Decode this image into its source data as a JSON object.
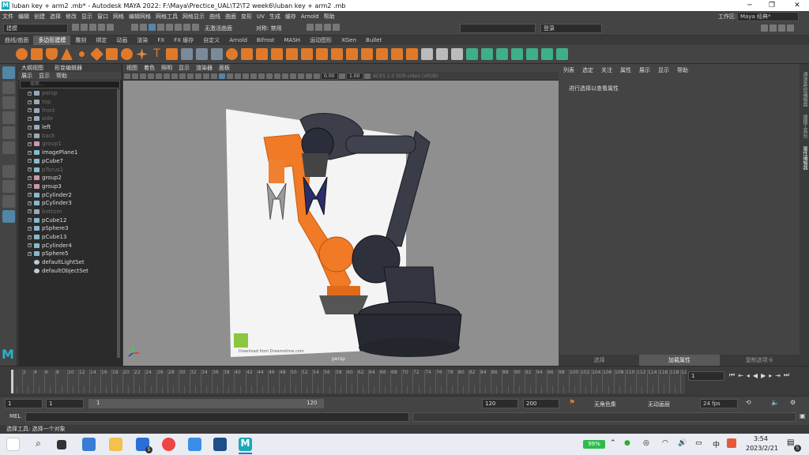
{
  "window": {
    "title": "luban key + arm2 .mb* - Autodesk MAYA 2022: F:\\Maya\\Prectice_UAL\\T2\\T2 week6\\luban key + arm2 .mb",
    "logo": "M"
  },
  "menubar": [
    "文件",
    "编辑",
    "创建",
    "选择",
    "修改",
    "显示",
    "窗口",
    "网格",
    "编辑网格",
    "网格工具",
    "网格显示",
    "曲线",
    "曲面",
    "变形",
    "UV",
    "生成",
    "缓存",
    "Arnold",
    "帮助"
  ],
  "workspace": {
    "label": "工作区:",
    "value": "Maya 经典*"
  },
  "statusline": {
    "mode": "建模",
    "symmetry": "对称: 禁用",
    "no_live": "无激活曲面",
    "login": "登录"
  },
  "shelf_tabs": [
    "曲线/曲面",
    "多边形建模",
    "雕刻",
    "绑定",
    "动画",
    "渲染",
    "FX",
    "FX 缓存",
    "自定义",
    "Arnold",
    "Bifrost",
    "MASH",
    "运动图形",
    "XGen",
    "Bullet"
  ],
  "shelf_active": "多边形建模",
  "outliner": {
    "title": "大纲视图",
    "title2": "形变编辑器",
    "menus": [
      "展示",
      "显示",
      "帮助"
    ],
    "search_placeholder": "搜索...",
    "items": [
      {
        "name": "persp",
        "type": "cam",
        "dim": true
      },
      {
        "name": "top",
        "type": "cam",
        "dim": true
      },
      {
        "name": "front",
        "type": "cam",
        "dim": true
      },
      {
        "name": "side",
        "type": "cam",
        "dim": true
      },
      {
        "name": "left",
        "type": "cam",
        "dim": false
      },
      {
        "name": "back",
        "type": "cam",
        "dim": true
      },
      {
        "name": "group1",
        "type": "grp",
        "dim": true
      },
      {
        "name": "imagePlane1",
        "type": "mesh",
        "dim": false
      },
      {
        "name": "pCube7",
        "type": "mesh",
        "dim": false
      },
      {
        "name": "pTorus1",
        "type": "mesh",
        "dim": true
      },
      {
        "name": "group2",
        "type": "grp",
        "dim": false
      },
      {
        "name": "group3",
        "type": "grp",
        "dim": false
      },
      {
        "name": "pCylinder2",
        "type": "mesh",
        "dim": false
      },
      {
        "name": "pCylinder3",
        "type": "mesh",
        "dim": false
      },
      {
        "name": "bottom",
        "type": "cam",
        "dim": true
      },
      {
        "name": "pCube12",
        "type": "mesh",
        "dim": false
      },
      {
        "name": "pSphere3",
        "type": "mesh",
        "dim": false
      },
      {
        "name": "pCube13",
        "type": "mesh",
        "dim": false
      },
      {
        "name": "pCylinder4",
        "type": "mesh",
        "dim": false
      },
      {
        "name": "pSphere5",
        "type": "mesh",
        "dim": false
      },
      {
        "name": "defaultLightSet",
        "type": "set",
        "dim": false
      },
      {
        "name": "defaultObjectSet",
        "type": "set",
        "dim": false
      }
    ]
  },
  "viewport": {
    "menus": [
      "视图",
      "着色",
      "照明",
      "显示",
      "渲染器",
      "面板"
    ],
    "exposure": "0.00",
    "gamma": "1.00",
    "colorspace": "ACES 1.0 SDR-video (sRGB)",
    "camera_label": "persp",
    "watermark": "Download from Dreamstime.com"
  },
  "attr_editor": {
    "tabs": [
      "列表",
      "选定",
      "关注",
      "属性",
      "展示",
      "显示",
      "帮助"
    ],
    "message": "进行选择以查看属性",
    "bottom": [
      "选择",
      "加载属性",
      "复制选项卡"
    ],
    "bottom_active": "加载属性"
  },
  "side_tabs": [
    "通道盒/层编辑器",
    "建模工具包",
    "属性编辑器"
  ],
  "timeline": {
    "current_frame": "1",
    "ticks": [
      "2",
      "4",
      "6",
      "8",
      "10",
      "12",
      "14",
      "16",
      "18",
      "20",
      "22",
      "24",
      "26",
      "28",
      "30",
      "32",
      "34",
      "36",
      "38",
      "40",
      "42",
      "44",
      "46",
      "48",
      "50",
      "52",
      "54",
      "56",
      "58",
      "60",
      "62",
      "64",
      "66",
      "68",
      "70",
      "72",
      "74",
      "76",
      "78",
      "80",
      "82",
      "84",
      "86",
      "88",
      "90",
      "92",
      "94",
      "96",
      "98",
      "100",
      "102",
      "104",
      "106",
      "108",
      "110",
      "112",
      "114",
      "116",
      "118",
      "12"
    ]
  },
  "range": {
    "start": "1",
    "start2": "1",
    "slider_start": "1",
    "slider_end": "120",
    "end": "120",
    "end2": "200",
    "char_set": "无角色集",
    "anim_layer": "无动画层",
    "fps": "24 fps"
  },
  "mel": {
    "label": "MEL"
  },
  "help_line": "选择工具: 选择一个对象",
  "taskbar": {
    "battery": "99%",
    "ime": "中",
    "time": "3:54",
    "date": "2023/2/21",
    "notif_count": "5",
    "mail_badge": "5"
  }
}
